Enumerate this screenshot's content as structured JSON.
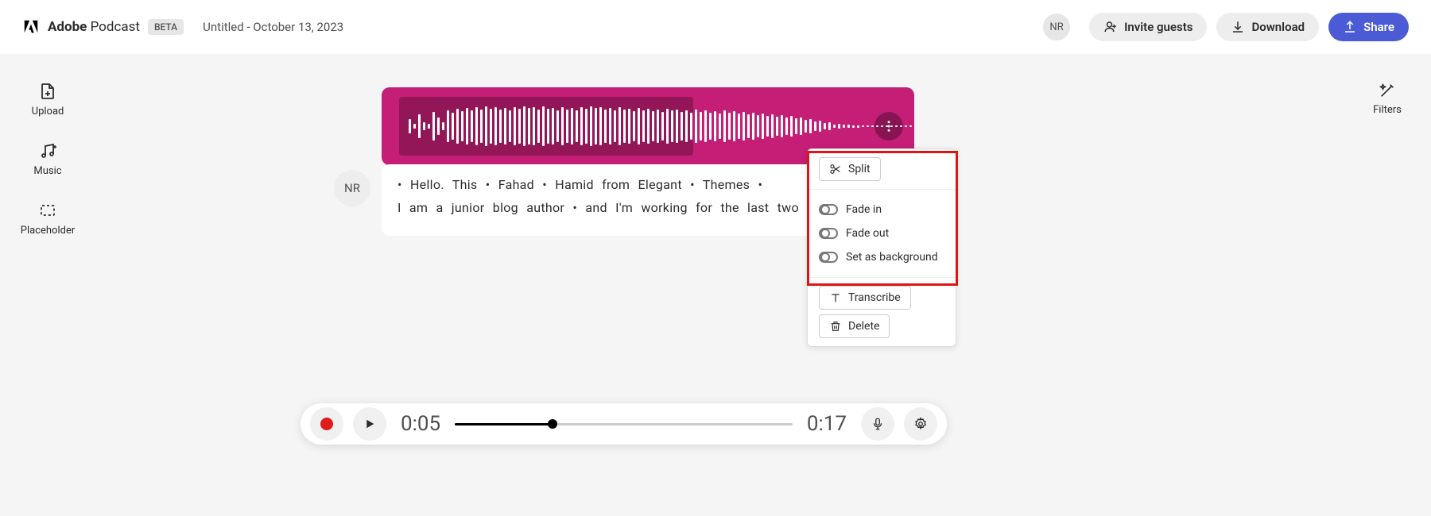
{
  "header": {
    "brand_bold": "Adobe",
    "brand_light": "Podcast",
    "beta": "BETA",
    "doc_title": "Untitled - October 13, 2023",
    "avatar": "NR",
    "invite": "Invite guests",
    "download": "Download",
    "share": "Share"
  },
  "sidebar": {
    "upload": "Upload",
    "music": "Music",
    "placeholder": "Placeholder"
  },
  "right": {
    "filters": "Filters"
  },
  "transcript": {
    "speaker": "NR",
    "line1": "• Hello.  This • Fahad • Hamid  from  Elegant • Themes •",
    "line2": "I  am  a  junior  blog  author • and  I'm  working  for  the  last  two  months. •"
  },
  "ctx": {
    "split": "Split",
    "fade_in": "Fade in",
    "fade_out": "Fade out",
    "set_bg": "Set as background",
    "transcribe": "Transcribe",
    "delete": "Delete"
  },
  "playbar": {
    "current": "0:05",
    "total": "0:17"
  }
}
